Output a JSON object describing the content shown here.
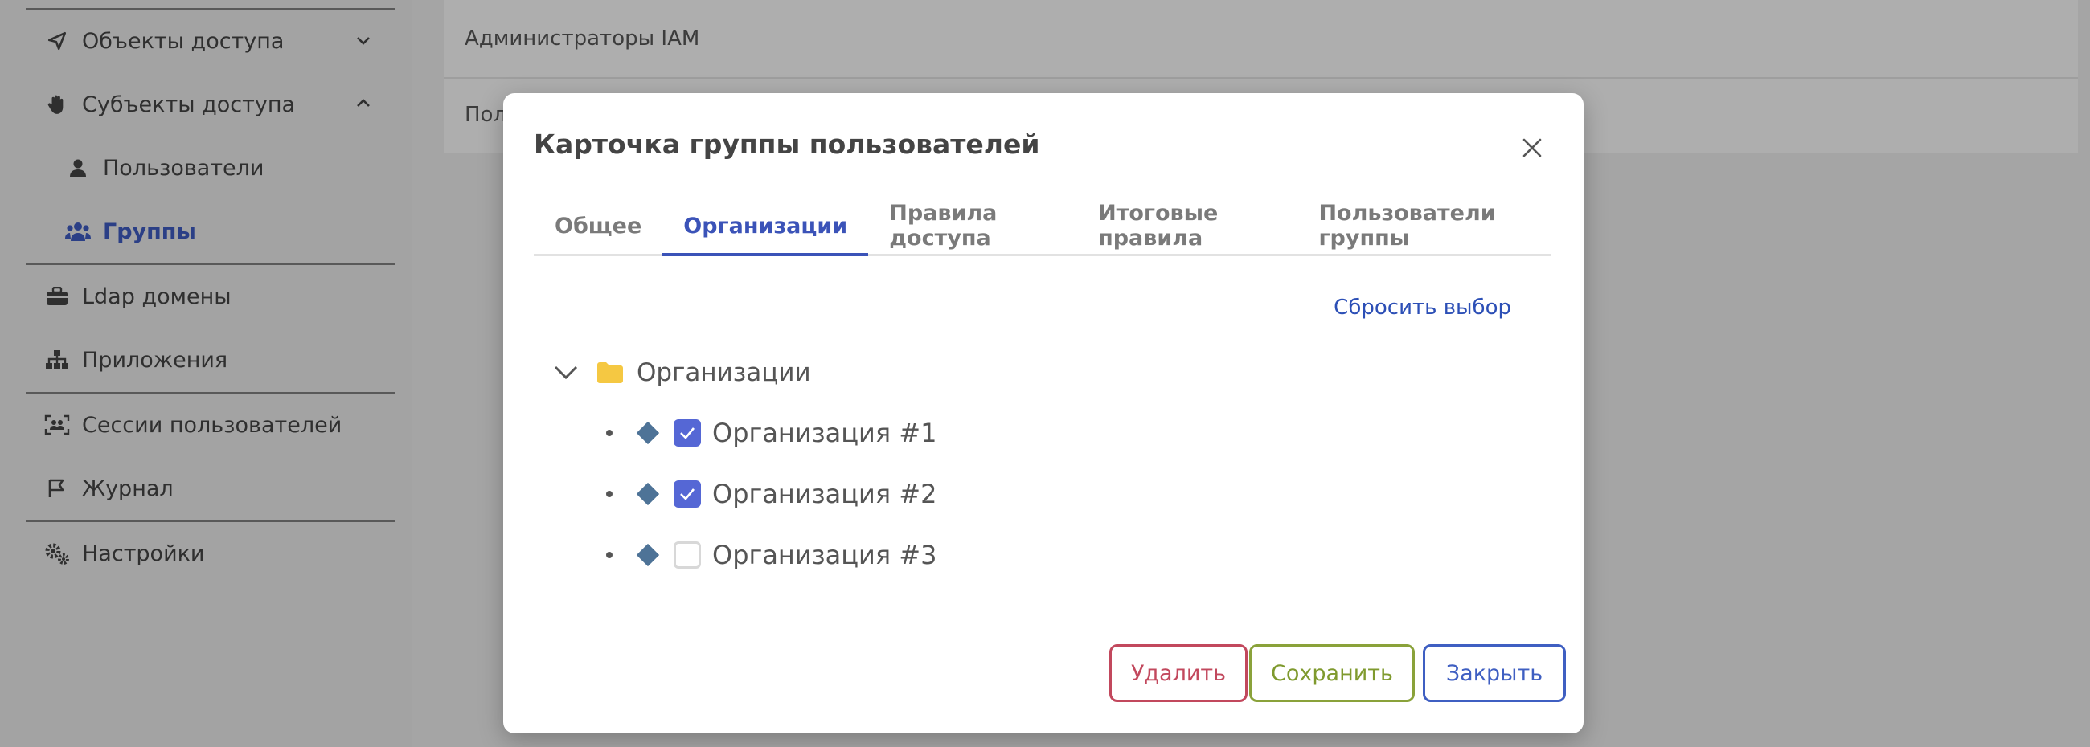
{
  "sidebar": {
    "items": [
      {
        "label": "Объекты доступа",
        "icon": "send-icon"
      },
      {
        "label": "Субъекты доступа",
        "icon": "hand-icon"
      },
      {
        "label": "Пользователи",
        "icon": "user-icon"
      },
      {
        "label": "Группы",
        "icon": "users-icon"
      },
      {
        "label": "Ldap домены",
        "icon": "briefcase-icon"
      },
      {
        "label": "Приложения",
        "icon": "sitemap-icon"
      },
      {
        "label": "Сессии пользователей",
        "icon": "sessions-icon"
      },
      {
        "label": "Журнал",
        "icon": "flag-icon"
      },
      {
        "label": "Настройки",
        "icon": "gears-icon"
      }
    ]
  },
  "main": {
    "rows": [
      "Администраторы IAM",
      "Пол"
    ]
  },
  "modal": {
    "title": "Карточка группы пользователей",
    "tabs": [
      "Общее",
      "Организации",
      "Правила доступа",
      "Итоговые правила",
      "Пользователи группы"
    ],
    "active_tab": "Организации",
    "reset_label": "Сбросить выбор",
    "tree": {
      "root_label": "Организации",
      "nodes": [
        {
          "label": "Организация #1",
          "checked": true
        },
        {
          "label": "Организация #2",
          "checked": true
        },
        {
          "label": "Организация #3",
          "checked": false
        }
      ]
    },
    "buttons": {
      "delete": "Удалить",
      "save": "Сохранить",
      "close": "Закрыть"
    }
  },
  "colors": {
    "accent": "#3b53b8",
    "checkbox": "#5567d5",
    "danger": "#c2485d",
    "success": "#8aa23a",
    "folder": "#f5c842"
  }
}
